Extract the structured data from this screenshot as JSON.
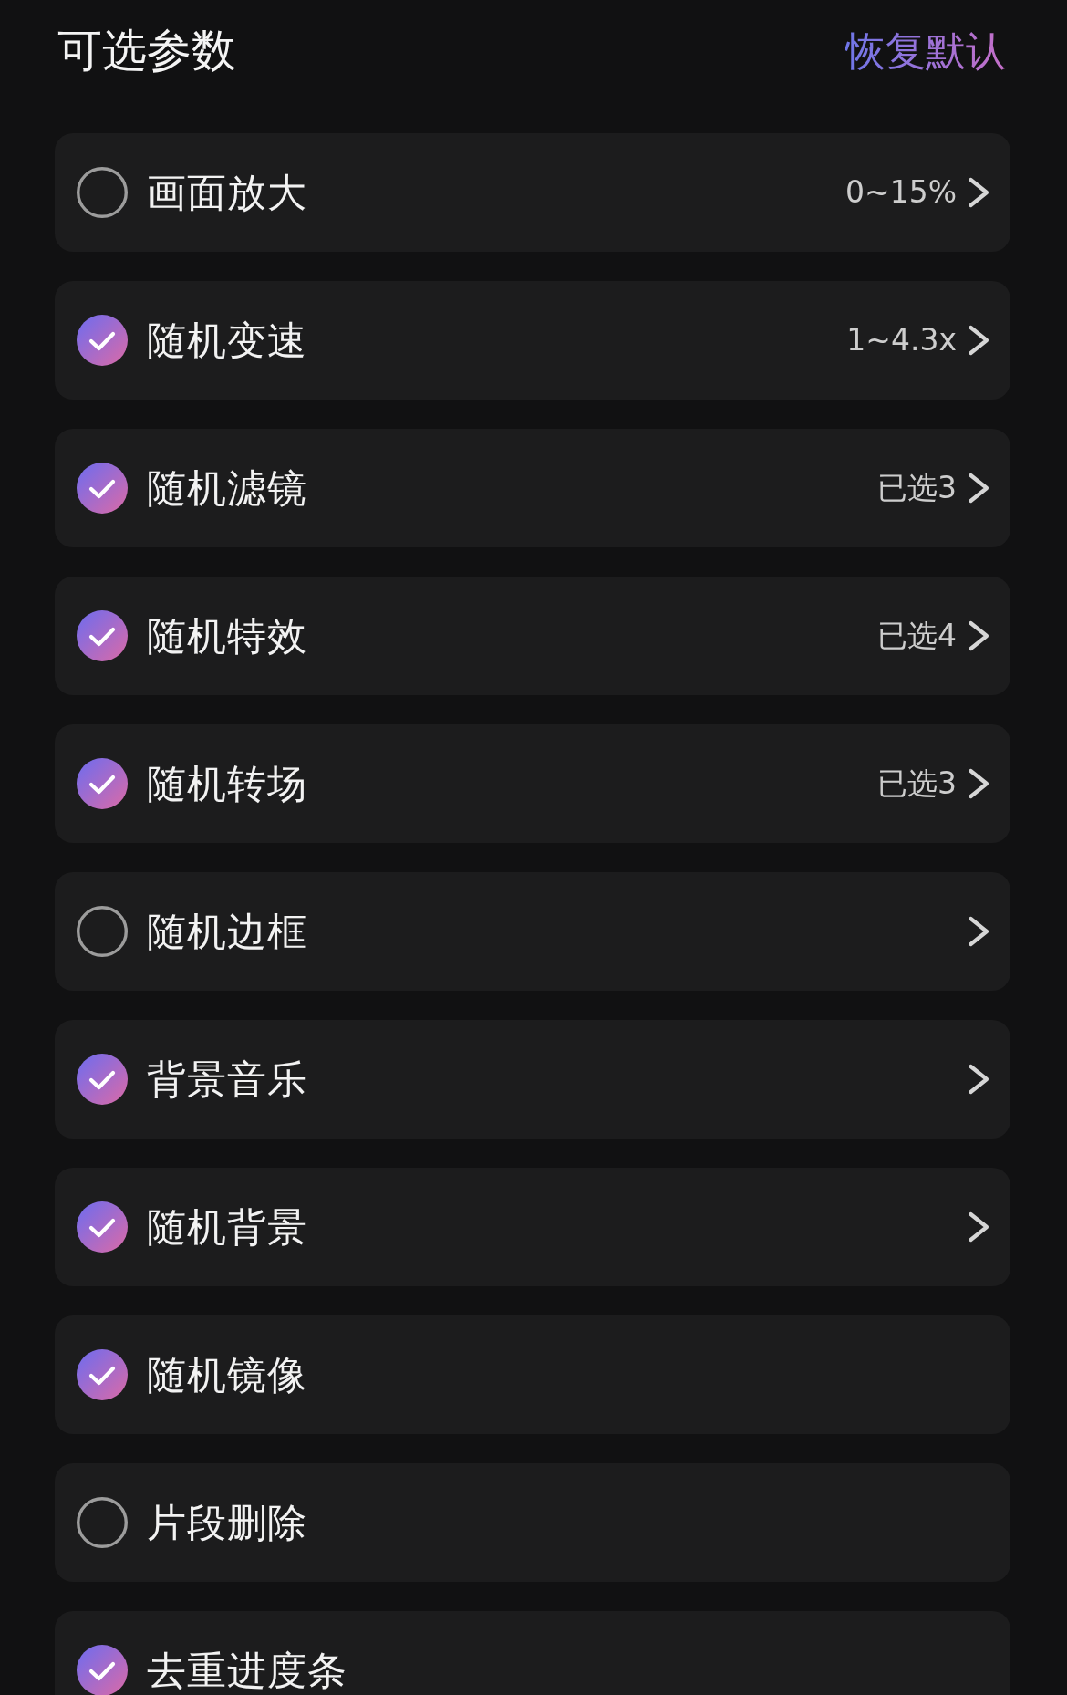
{
  "header": {
    "title": "可选参数",
    "reset_link": "恢复默认"
  },
  "options": [
    {
      "label": "画面放大",
      "checked": false,
      "kind": "detail",
      "value": "0~15%"
    },
    {
      "label": "随机变速",
      "checked": true,
      "kind": "detail",
      "value": "1~4.3x"
    },
    {
      "label": "随机滤镜",
      "checked": true,
      "kind": "detail",
      "value": "已选3"
    },
    {
      "label": "随机特效",
      "checked": true,
      "kind": "detail",
      "value": "已选4"
    },
    {
      "label": "随机转场",
      "checked": true,
      "kind": "detail",
      "value": "已选3"
    },
    {
      "label": "随机边框",
      "checked": false,
      "kind": "detail"
    },
    {
      "label": "背景音乐",
      "checked": true,
      "kind": "detail"
    },
    {
      "label": "随机背景",
      "checked": true,
      "kind": "detail"
    },
    {
      "label": "随机镜像",
      "checked": true,
      "kind": "plain"
    },
    {
      "label": "片段删除",
      "checked": false,
      "kind": "plain"
    },
    {
      "label": "去重进度条",
      "checked": true,
      "kind": "plain"
    }
  ]
}
